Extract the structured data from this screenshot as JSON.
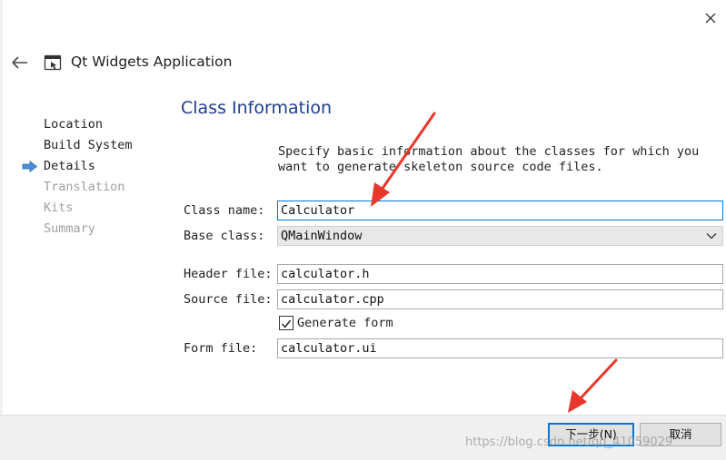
{
  "window": {
    "title": "Qt Widgets Application",
    "close_icon": "close-icon",
    "back_icon": "back-arrow-icon",
    "app_icon": "qt-window-icon"
  },
  "steps": [
    {
      "label": "Location",
      "state": "done"
    },
    {
      "label": "Build System",
      "state": "done"
    },
    {
      "label": "Details",
      "state": "current"
    },
    {
      "label": "Translation",
      "state": "pending"
    },
    {
      "label": "Kits",
      "state": "pending"
    },
    {
      "label": "Summary",
      "state": "pending"
    }
  ],
  "page": {
    "heading": "Class Information",
    "description": "Specify basic information about the classes for which you want to generate skeleton source code files."
  },
  "form": {
    "class_name": {
      "label": "Class name:",
      "value": "Calculator"
    },
    "base_class": {
      "label": "Base class:",
      "value": "QMainWindow"
    },
    "header_file": {
      "label": "Header file:",
      "value": "calculator.h"
    },
    "source_file": {
      "label": "Source file:",
      "value": "calculator.cpp"
    },
    "generate_form": {
      "label": "Generate form",
      "checked": true
    },
    "form_file": {
      "label": "Form file:",
      "value": "calculator.ui"
    }
  },
  "buttons": {
    "next": "下一步(N)",
    "cancel": "取消"
  },
  "watermark": "https://blog.csdn.net/qq_41059029",
  "colors": {
    "heading": "#1b3e8e",
    "current_step_arrow": "#4a90d9",
    "focus_border": "#0078d7",
    "annotation_arrow": "#e8372b"
  }
}
